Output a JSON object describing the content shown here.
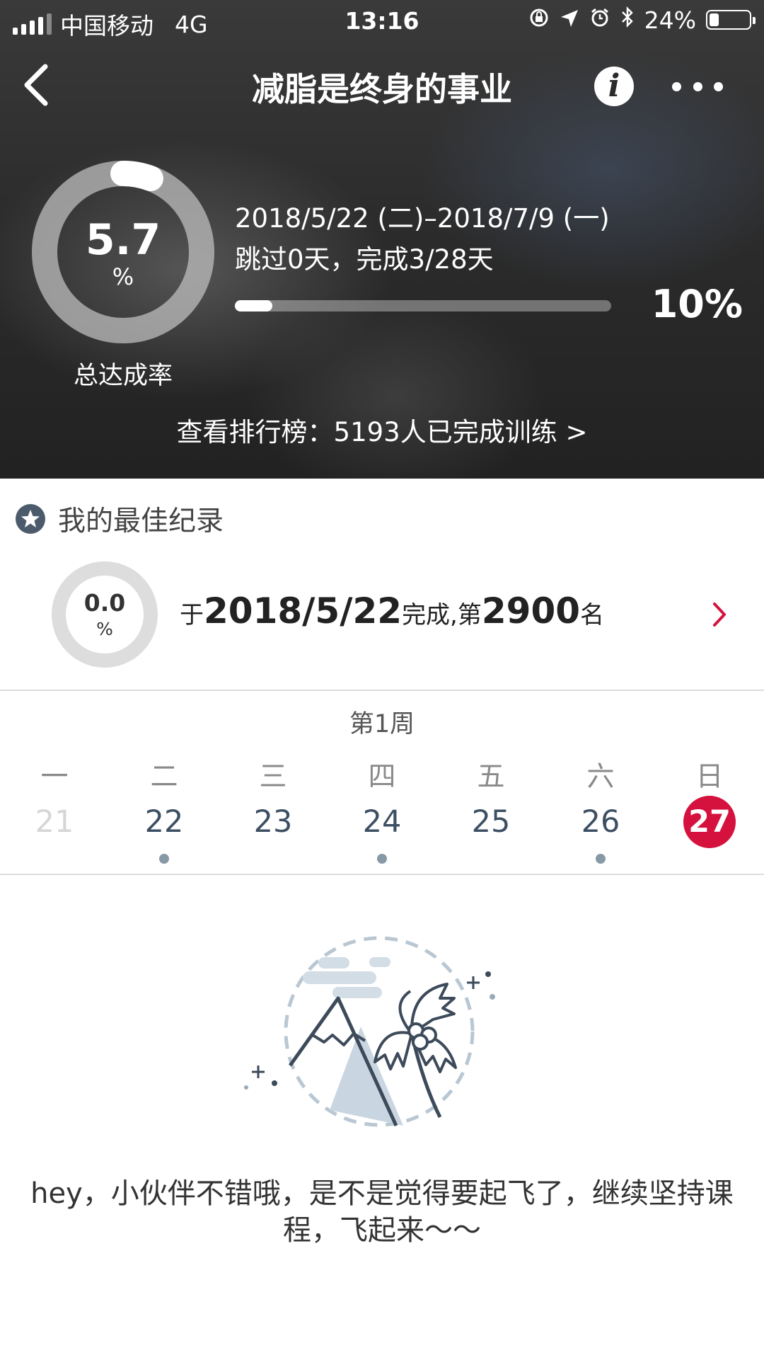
{
  "status_bar": {
    "carrier": "中国移动",
    "network": "4G",
    "time": "13:16",
    "battery": "24%",
    "battery_level": 0.24
  },
  "nav": {
    "title": "减脂是终身的事业",
    "info_icon": "info-icon",
    "more_icon": "more-dots-icon",
    "back_icon": "back-chevron-icon"
  },
  "summary": {
    "rate_value": "5.7",
    "rate_unit": "%",
    "rate_label": "总达成率",
    "rate_fraction": 0.057,
    "date_range": "2018/5/22 (二)–2018/7/9 (一)",
    "progress_text": "跳过0天，完成3/28天",
    "progress_percent": "10%",
    "progress_fraction": 0.1,
    "ranking_link": "查看排行榜：5193人已完成训练 >"
  },
  "best_record": {
    "title": "我的最佳纪录",
    "rate_value": "0.0",
    "rate_unit": "%",
    "prefix": "于",
    "date": "2018/5/22",
    "middle": "完成,第",
    "rank": "2900",
    "suffix": "名"
  },
  "week": {
    "label": "第1周",
    "days": [
      {
        "weekday": "一",
        "date": "21",
        "faded": true,
        "dot": false,
        "today": false
      },
      {
        "weekday": "二",
        "date": "22",
        "faded": false,
        "dot": true,
        "today": false
      },
      {
        "weekday": "三",
        "date": "23",
        "faded": false,
        "dot": false,
        "today": false
      },
      {
        "weekday": "四",
        "date": "24",
        "faded": false,
        "dot": true,
        "today": false
      },
      {
        "weekday": "五",
        "date": "25",
        "faded": false,
        "dot": false,
        "today": false
      },
      {
        "weekday": "六",
        "date": "26",
        "faded": false,
        "dot": true,
        "today": false
      },
      {
        "weekday": "日",
        "date": "27",
        "faded": false,
        "dot": false,
        "today": true
      }
    ]
  },
  "message": "hey，小伙伴不错哦，是不是觉得要起飞了，继续坚持课程，飞起来～～",
  "colors": {
    "accent": "#d5113d",
    "date_text": "#3d4f63",
    "dot": "#8899a6"
  }
}
